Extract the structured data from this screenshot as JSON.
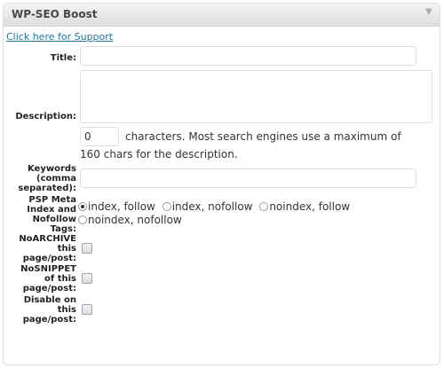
{
  "panel": {
    "title": "WP-SEO Boost",
    "toggle_icon": "triangle-down-icon"
  },
  "support_link": "Click here for Support",
  "fields": {
    "title_label": "Title:",
    "title_value": "",
    "description_label": "Description:",
    "description_value": "",
    "char_count": "0",
    "char_help_line1": "characters. Most search engines use a maximum of",
    "char_help_line2": "160 chars for the description.",
    "keywords_label_l1": "Keywords",
    "keywords_label_l2": "(comma",
    "keywords_label_l3": "separated):",
    "keywords_value": "",
    "meta_label_l1": "PSP Meta",
    "meta_label_l2": "Index and",
    "meta_label_l3": "Nofollow",
    "meta_label_l4": "Tags:",
    "meta_options": [
      "index, follow",
      "index, nofollow",
      "noindex, follow",
      "noindex, nofollow"
    ],
    "meta_selected": "index, follow",
    "noarchive_l1": "NoARCHIVE",
    "noarchive_l2": "this",
    "noarchive_l3": "page/post:",
    "nosnippet_l1": "NoSNIPPET",
    "nosnippet_l2": "of this",
    "nosnippet_l3": "page/post:",
    "disable_l1": "Disable on",
    "disable_l2": "this",
    "disable_l3": "page/post:"
  }
}
